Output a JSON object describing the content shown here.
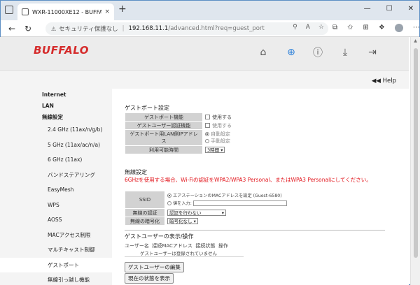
{
  "browser": {
    "tab_title": "WXR-11000XE12 - BUFFALO Air",
    "tab_close": "×",
    "new_tab": "+",
    "url_lock_text": "セキュリティ保護なし",
    "url_host": "192.168.11.1",
    "url_path": "/advanced.html?req=guest_port",
    "minimize": "—",
    "maximize": "☐",
    "close": "✕"
  },
  "header": {
    "logo": "BUFFALO",
    "help_label": "Help"
  },
  "sidebar": {
    "items": [
      {
        "label": "Internet",
        "type": "main"
      },
      {
        "label": "LAN",
        "type": "main"
      },
      {
        "label": "無線設定",
        "type": "main"
      },
      {
        "label": "2.4 GHz (11ax/n/g/b)",
        "type": "sub"
      },
      {
        "label": "5 GHz (11ax/ac/n/a)",
        "type": "sub"
      },
      {
        "label": "6 GHz (11ax)",
        "type": "sub"
      },
      {
        "label": "バンドステアリング",
        "type": "sub"
      },
      {
        "label": "EasyMesh",
        "type": "sub"
      },
      {
        "label": "WPS",
        "type": "sub"
      },
      {
        "label": "AOSS",
        "type": "sub"
      },
      {
        "label": "MACアクセス制限",
        "type": "sub"
      },
      {
        "label": "マルチキャスト制御",
        "type": "sub"
      },
      {
        "label": "ゲストポート",
        "type": "sub",
        "active": true
      },
      {
        "label": "無線引っ越し機能",
        "type": "sub"
      },
      {
        "label": "セキュリティー",
        "type": "main"
      }
    ]
  },
  "guest_port": {
    "title": "ゲストポート設定",
    "function_label": "ゲストポート機能",
    "function_value": "使用する",
    "auth_label": "ゲストユーザー認証機能",
    "auth_value": "使用する",
    "ip_label": "ゲストポート用LAN側IPアドレス",
    "ip_auto": "自動設定",
    "ip_manual": "手動設定",
    "time_label": "利用可能時間",
    "time_value": "3時間"
  },
  "wireless": {
    "title": "無線設定",
    "warning": "6GHzを使用する場合、Wi-Fiの認証をWPA2/WPA3 Personal、またはWPA3 Personalにしてください。",
    "ssid_label": "SSID",
    "ssid_opt1": "エアステーションのMACアドレスを設定 (Guest-6580)",
    "ssid_opt2": "値を入力:",
    "auth_label": "無線の認証",
    "auth_value": "認証を行わない",
    "enc_label": "無線の暗号化",
    "enc_value": "暗号化なし"
  },
  "guest_users": {
    "title": "ゲストユーザーの表示/操作",
    "col_user": "ユーザー名",
    "col_mac": "接続MACアドレス",
    "col_status": "接続状態",
    "col_op": "操作",
    "empty": "ゲストユーザーは登録されていません",
    "edit_button": "ゲストユーザーの編集",
    "show_button": "現在の状態を表示"
  }
}
